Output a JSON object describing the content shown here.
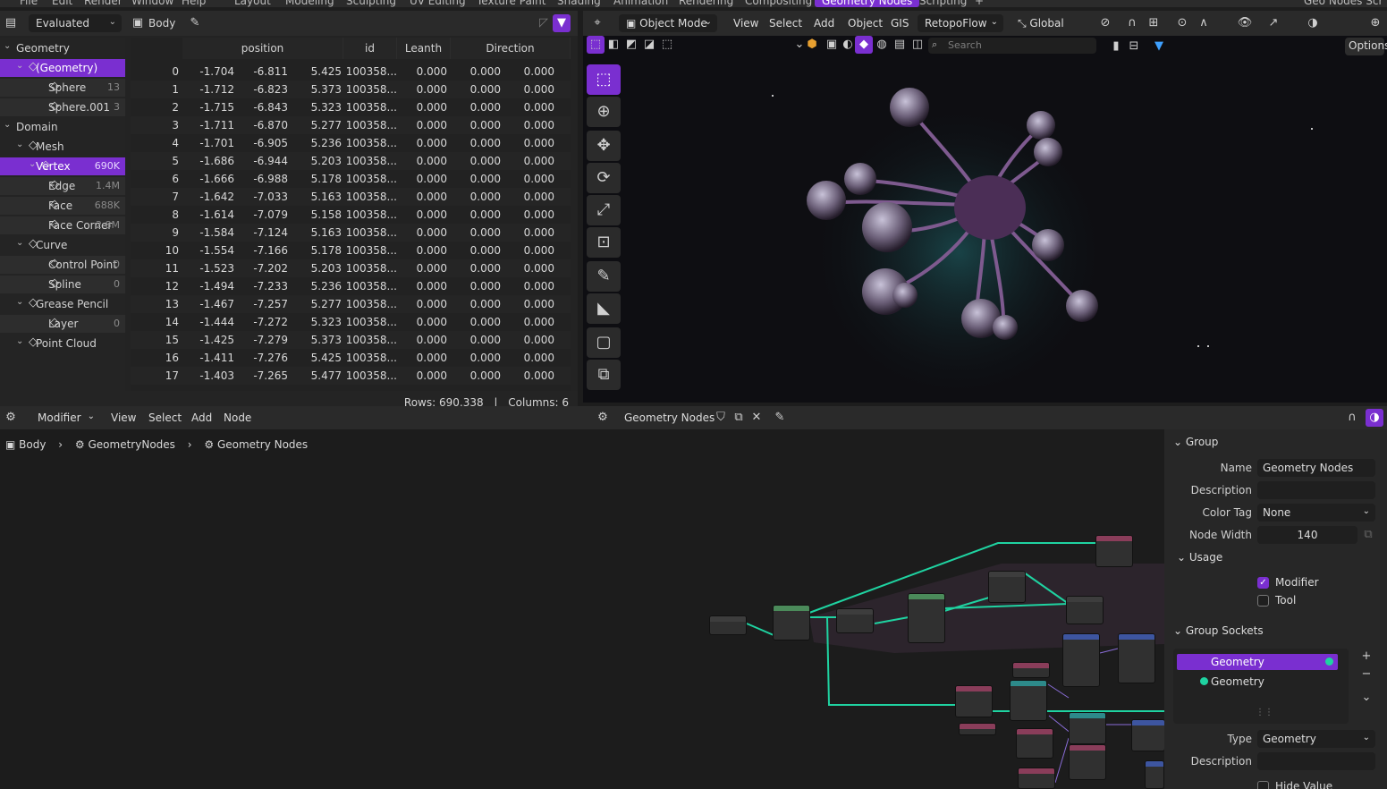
{
  "menubar": {
    "items": [
      "File",
      "Edit",
      "Render",
      "Window",
      "Help"
    ],
    "workspaces": [
      "Layout",
      "Modeling",
      "Sculpting",
      "UV Editing",
      "Texture Paint",
      "Shading",
      "Animation",
      "Rendering",
      "Compositing",
      "Geometry Nodes",
      "Scripting"
    ],
    "active_workspace": "Geometry Nodes",
    "scene_name": "Geo Nodes Scr"
  },
  "spreadsheet": {
    "evaluation": "Evaluated",
    "object_name": "Body",
    "tree": [
      {
        "label": "Geometry",
        "kind": "header",
        "indent": 0
      },
      {
        "label": "(Geometry)",
        "kind": "selected",
        "indent": 1
      },
      {
        "label": "Sphere",
        "count": "13",
        "kind": "item",
        "indent": 2
      },
      {
        "label": "Sphere.001",
        "count": "3",
        "kind": "item",
        "indent": 2
      },
      {
        "label": "Domain",
        "kind": "header",
        "indent": 0
      },
      {
        "label": "Mesh",
        "kind": "subheader",
        "indent": 1
      },
      {
        "label": "Vertex",
        "count": "690K",
        "kind": "selected",
        "indent": 2
      },
      {
        "label": "Edge",
        "count": "1.4M",
        "kind": "item",
        "indent": 2
      },
      {
        "label": "Face",
        "count": "688K",
        "kind": "item",
        "indent": 2
      },
      {
        "label": "Face Corner",
        "count": "2.8M",
        "kind": "item",
        "indent": 2
      },
      {
        "label": "Curve",
        "kind": "subheader",
        "indent": 1
      },
      {
        "label": "Control Point",
        "count": "0",
        "kind": "item",
        "indent": 2
      },
      {
        "label": "Spline",
        "count": "0",
        "kind": "item",
        "indent": 2
      },
      {
        "label": "Grease Pencil",
        "kind": "subheader",
        "indent": 1
      },
      {
        "label": "Layer",
        "count": "0",
        "kind": "item",
        "indent": 2
      },
      {
        "label": "Point Cloud",
        "kind": "subheader",
        "indent": 1
      }
    ],
    "columns": [
      "position",
      "id",
      "Leanth",
      "Direction"
    ],
    "rows": [
      [
        "0",
        "-1.704",
        "-6.811",
        "5.425",
        "100358...",
        "0.000",
        "0.000",
        "0.000"
      ],
      [
        "1",
        "-1.712",
        "-6.823",
        "5.373",
        "100358...",
        "0.000",
        "0.000",
        "0.000"
      ],
      [
        "2",
        "-1.715",
        "-6.843",
        "5.323",
        "100358...",
        "0.000",
        "0.000",
        "0.000"
      ],
      [
        "3",
        "-1.711",
        "-6.870",
        "5.277",
        "100358...",
        "0.000",
        "0.000",
        "0.000"
      ],
      [
        "4",
        "-1.701",
        "-6.905",
        "5.236",
        "100358...",
        "0.000",
        "0.000",
        "0.000"
      ],
      [
        "5",
        "-1.686",
        "-6.944",
        "5.203",
        "100358...",
        "0.000",
        "0.000",
        "0.000"
      ],
      [
        "6",
        "-1.666",
        "-6.988",
        "5.178",
        "100358...",
        "0.000",
        "0.000",
        "0.000"
      ],
      [
        "7",
        "-1.642",
        "-7.033",
        "5.163",
        "100358...",
        "0.000",
        "0.000",
        "0.000"
      ],
      [
        "8",
        "-1.614",
        "-7.079",
        "5.158",
        "100358...",
        "0.000",
        "0.000",
        "0.000"
      ],
      [
        "9",
        "-1.584",
        "-7.124",
        "5.163",
        "100358...",
        "0.000",
        "0.000",
        "0.000"
      ],
      [
        "10",
        "-1.554",
        "-7.166",
        "5.178",
        "100358...",
        "0.000",
        "0.000",
        "0.000"
      ],
      [
        "11",
        "-1.523",
        "-7.202",
        "5.203",
        "100358...",
        "0.000",
        "0.000",
        "0.000"
      ],
      [
        "12",
        "-1.494",
        "-7.233",
        "5.236",
        "100358...",
        "0.000",
        "0.000",
        "0.000"
      ],
      [
        "13",
        "-1.467",
        "-7.257",
        "5.277",
        "100358...",
        "0.000",
        "0.000",
        "0.000"
      ],
      [
        "14",
        "-1.444",
        "-7.272",
        "5.323",
        "100358...",
        "0.000",
        "0.000",
        "0.000"
      ],
      [
        "15",
        "-1.425",
        "-7.279",
        "5.373",
        "100358...",
        "0.000",
        "0.000",
        "0.000"
      ],
      [
        "16",
        "-1.411",
        "-7.276",
        "5.425",
        "100358...",
        "0.000",
        "0.000",
        "0.000"
      ],
      [
        "17",
        "-1.403",
        "-7.265",
        "5.477",
        "100358...",
        "0.000",
        "0.000",
        "0.000"
      ]
    ],
    "footer": {
      "rows": "Rows: 690,338",
      "separator": "|",
      "columns": "Columns: 6"
    }
  },
  "viewport": {
    "mode": "Object Mode",
    "menus": [
      "View",
      "Select",
      "Add",
      "Object",
      "GIS"
    ],
    "addon": "RetopoFlow",
    "orientation": "Global",
    "search_placeholder": "Search",
    "options_label": "Options"
  },
  "node_editor": {
    "mode": "Modifier",
    "menus": [
      "View",
      "Select",
      "Add",
      "Node"
    ],
    "tree_name": "Geometry Nodes",
    "breadcrumb": [
      "Body",
      "GeometryNodes",
      "Geometry Nodes"
    ]
  },
  "npanel": {
    "group_title": "Group",
    "name_label": "Name",
    "name_value": "Geometry Nodes",
    "description_label": "Description",
    "color_tag_label": "Color Tag",
    "color_tag_value": "None",
    "node_width_label": "Node Width",
    "node_width_value": "140",
    "usage_title": "Usage",
    "modifier_label": "Modifier",
    "modifier_checked": true,
    "tool_label": "Tool",
    "tool_checked": false,
    "sockets_title": "Group Sockets",
    "sockets": [
      {
        "label": "Geometry",
        "selected": true
      },
      {
        "label": "Geometry",
        "selected": false
      }
    ],
    "type_label": "Type",
    "type_value": "Geometry",
    "socket_description_label": "Description",
    "hide_value_label": "Hide Value"
  },
  "colors": {
    "accent": "#7a2fd0",
    "geometry_socket": "#1fd3a1",
    "background": "#1d1d1d"
  }
}
